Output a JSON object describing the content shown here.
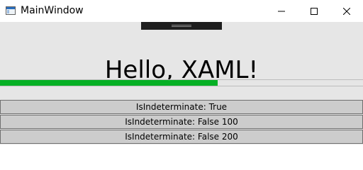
{
  "window": {
    "title": "MainWindow"
  },
  "heading": "Hello, XAML!",
  "progress": {
    "value": 0.6
  },
  "buttons": [
    {
      "label": "IsIndeterminate: True"
    },
    {
      "label": "IsIndeterminate: False 100"
    },
    {
      "label": "IsIndeterminate: False 200"
    }
  ],
  "icons": {
    "app": "app-window-icon",
    "minimize": "minimize-icon",
    "maximize": "maximize-icon",
    "close": "close-icon"
  },
  "colors": {
    "progress_fill": "#06b025",
    "button_bg": "#cccccc"
  }
}
